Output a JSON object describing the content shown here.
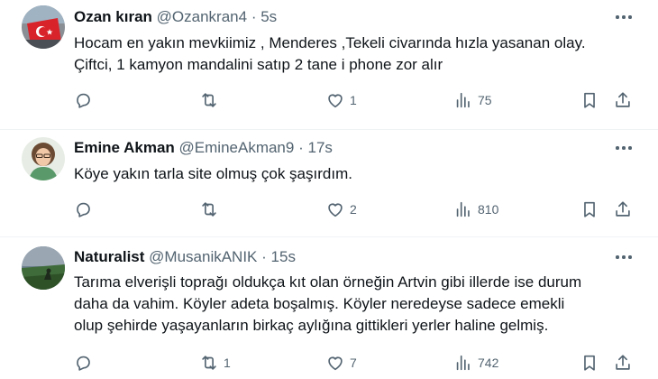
{
  "tweets": [
    {
      "name": "Ozan kıran",
      "handle": "@Ozankran4",
      "sep": "·",
      "time": "5s",
      "text": "Hocam en yakın mevkiimiz ,  Menderes ,Tekeli civarında hızla yasanan olay.\nÇiftci, 1 kamyon mandalini satıp 2 tane i phone zor alır",
      "reply_count": "",
      "repost_count": "",
      "like_count": "1",
      "view_count": "75"
    },
    {
      "name": "Emine Akman",
      "handle": "@EmineAkman9",
      "sep": "·",
      "time": "17s",
      "text": "Köye yakın tarla site olmuş çok şaşırdım.",
      "reply_count": "",
      "repost_count": "",
      "like_count": "2",
      "view_count": "810"
    },
    {
      "name": "Naturalist",
      "handle": "@MusanikANIK",
      "sep": "·",
      "time": "15s",
      "text": "Tarıma elverişli toprağı oldukça kıt olan örneğin Artvin gibi illerde ise durum\ndaha da vahim. Köyler adeta boşalmış. Köyler neredeyse sadece emekli\nolup şehirde yaşayanların birkaç aylığına gittikleri yerler haline gelmiş.",
      "reply_count": "",
      "repost_count": "1",
      "like_count": "7",
      "view_count": "742"
    }
  ],
  "colors": {
    "text": "#0f1419",
    "muted": "#536471",
    "divider": "#eff3f4"
  },
  "icons": [
    "more-icon",
    "reply-icon",
    "repost-icon",
    "like-icon",
    "views-icon",
    "bookmark-icon",
    "share-icon"
  ]
}
